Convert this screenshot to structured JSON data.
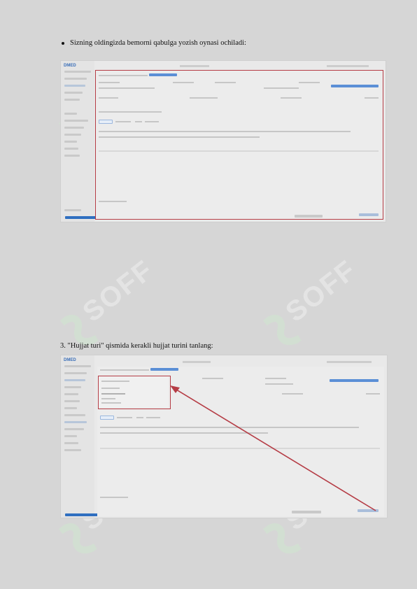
{
  "document": {
    "bullet_text": "Sizning oldingizda bemorni qabulga yozish oynasi ochiladi:",
    "step3_text": "3. \"Hujjat turi\" qismida kerakli hujjat turini tanlang:"
  },
  "watermark": {
    "text": "SOFF",
    "color_light": "#f1f1f1",
    "color_mark": "#cfe8cf"
  },
  "screenshot1": {
    "logo": "DMED",
    "highlight_color": "#b53c45"
  },
  "screenshot2": {
    "logo": "DMED",
    "arrow_color": "#b53c45"
  }
}
